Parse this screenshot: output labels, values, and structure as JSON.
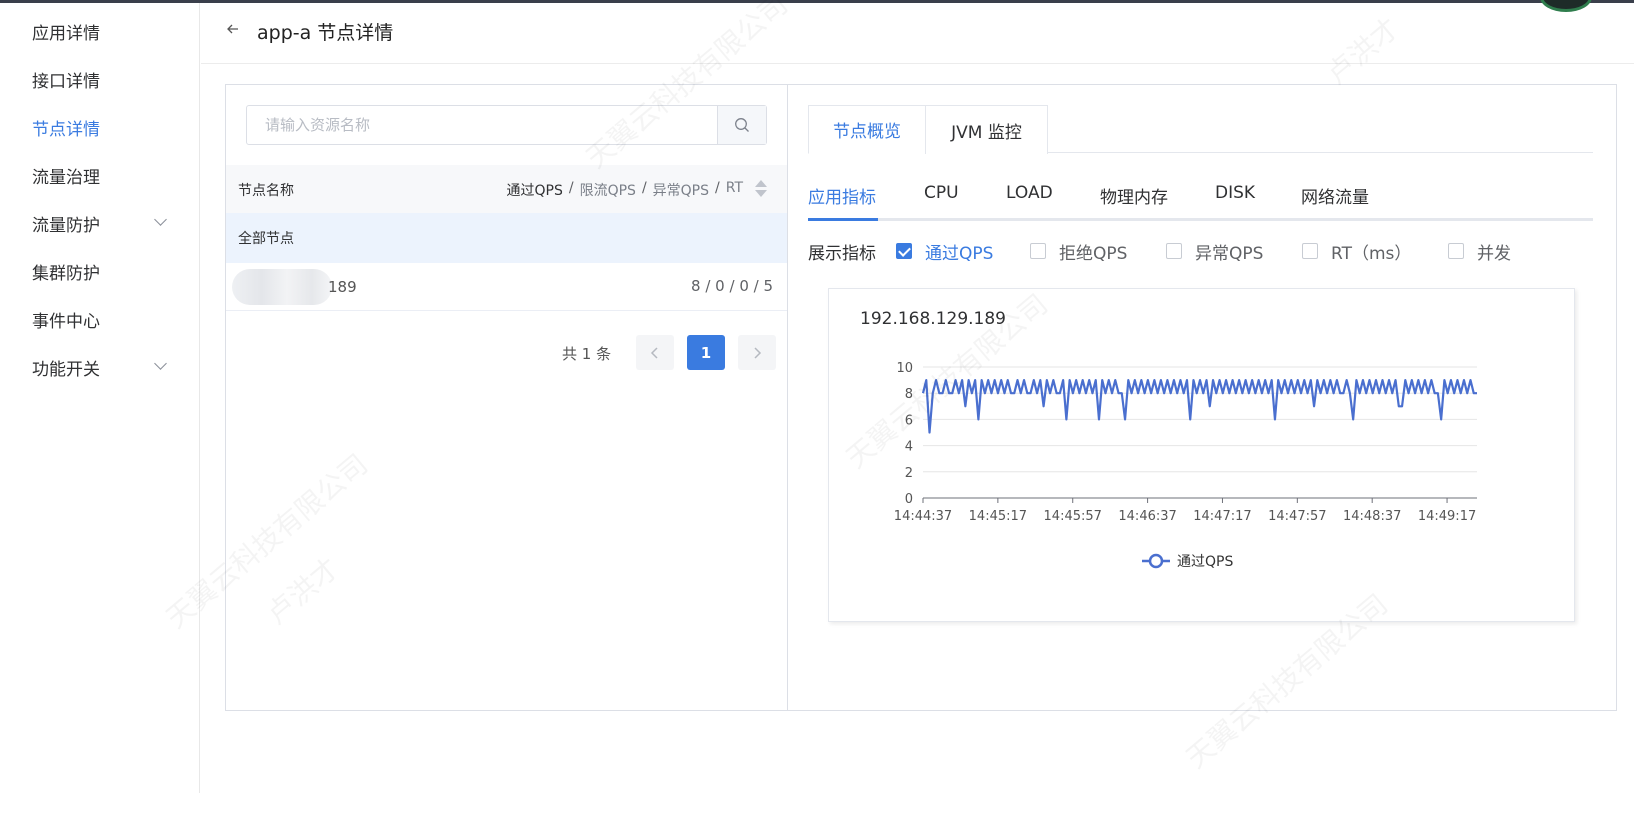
{
  "sidebar": {
    "items": [
      {
        "label": "应用详情",
        "active": false,
        "expandable": false
      },
      {
        "label": "接口详情",
        "active": false,
        "expandable": false
      },
      {
        "label": "节点详情",
        "active": true,
        "expandable": false
      },
      {
        "label": "流量治理",
        "active": false,
        "expandable": false
      },
      {
        "label": "流量防护",
        "active": false,
        "expandable": true
      },
      {
        "label": "集群防护",
        "active": false,
        "expandable": false
      },
      {
        "label": "事件中心",
        "active": false,
        "expandable": false
      },
      {
        "label": "功能开关",
        "active": false,
        "expandable": true
      }
    ]
  },
  "header": {
    "back_icon": "arrow-left-icon",
    "title": "app-a 节点详情"
  },
  "node_list": {
    "search_placeholder": "请输入资源名称",
    "search_icon": "search-icon",
    "columns": {
      "name": "节点名称",
      "metric_pass": "通过QPS",
      "metric_block": "限流QPS",
      "metric_exception": "异常QPS",
      "metric_rt": "RT",
      "separator": "/"
    },
    "all_nodes_label": "全部节点",
    "rows": [
      {
        "name_suffix": "189",
        "metrics": "8 / 0 / 0 / 5"
      }
    ],
    "pagination": {
      "total": "共 1 条",
      "current_page": "1",
      "prev_icon": "chevron-left-icon",
      "next_icon": "chevron-right-icon"
    }
  },
  "detail": {
    "tabs": [
      {
        "label": "节点概览",
        "active": true
      },
      {
        "label": "JVM 监控",
        "active": false
      }
    ],
    "sub_tabs": [
      {
        "label": "应用指标",
        "active": true
      },
      {
        "label": "CPU",
        "active": false
      },
      {
        "label": "LOAD",
        "active": false
      },
      {
        "label": "物理内存",
        "active": false
      },
      {
        "label": "DISK",
        "active": false
      },
      {
        "label": "网络流量",
        "active": false
      }
    ],
    "metrics_label": "展示指标",
    "metric_options": [
      {
        "label": "通过QPS",
        "checked": true
      },
      {
        "label": "拒绝QPS",
        "checked": false
      },
      {
        "label": "异常QPS",
        "checked": false
      },
      {
        "label": "RT（ms）",
        "checked": false
      },
      {
        "label": "并发",
        "checked": false
      }
    ]
  },
  "colors": {
    "accent": "#3a7be0",
    "series": "#4a6fcf"
  },
  "watermark": {
    "lines": [
      "天翼云科技有限公司",
      "卢洪才"
    ]
  },
  "chart_data": {
    "type": "line",
    "title": "192.168.129.189",
    "xlabel": "",
    "ylabel": "",
    "ylim": [
      0,
      10
    ],
    "yticks": [
      0,
      2,
      4,
      6,
      8,
      10
    ],
    "xticks": [
      "14:44:37",
      "14:45:17",
      "14:45:57",
      "14:46:37",
      "14:47:17",
      "14:47:57",
      "14:48:37",
      "14:49:17"
    ],
    "grid": true,
    "legend": "bottom-center",
    "series": [
      {
        "name": "通过QPS",
        "values": [
          8,
          9,
          5,
          8,
          9,
          8,
          8,
          9,
          8,
          8,
          9,
          8,
          9,
          7,
          9,
          8,
          9,
          6,
          9,
          8,
          9,
          8,
          9,
          8,
          9,
          8,
          9,
          8,
          8,
          9,
          8,
          9,
          8,
          8,
          9,
          8,
          9,
          7,
          9,
          8,
          9,
          8,
          8,
          9,
          6,
          9,
          8,
          9,
          8,
          9,
          8,
          9,
          8,
          9,
          6,
          9,
          8,
          9,
          8,
          9,
          8,
          8,
          6,
          9,
          8,
          9,
          8,
          9,
          8,
          9,
          8,
          9,
          8,
          9,
          8,
          9,
          8,
          9,
          8,
          9,
          8,
          9,
          6,
          9,
          8,
          9,
          8,
          9,
          7,
          9,
          8,
          9,
          8,
          9,
          8,
          9,
          8,
          9,
          8,
          9,
          8,
          9,
          8,
          9,
          8,
          9,
          8,
          9,
          6,
          9,
          8,
          9,
          8,
          9,
          8,
          9,
          8,
          9,
          8,
          9,
          7,
          9,
          8,
          9,
          8,
          9,
          8,
          9,
          8,
          8,
          9,
          8,
          6,
          9,
          8,
          9,
          8,
          9,
          8,
          9,
          8,
          9,
          8,
          9,
          8,
          9,
          7,
          7,
          9,
          8,
          9,
          8,
          9,
          8,
          9,
          8,
          9,
          8,
          8,
          6,
          9,
          8,
          9,
          8,
          9,
          8,
          9,
          8,
          9,
          8,
          8
        ]
      }
    ]
  }
}
